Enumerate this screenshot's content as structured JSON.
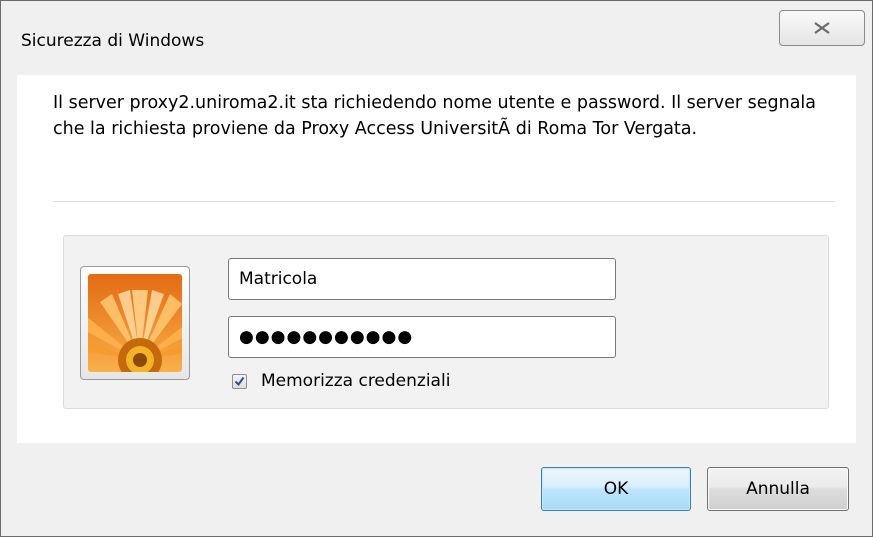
{
  "window": {
    "title": "Sicurezza di Windows",
    "close_icon": "close-icon"
  },
  "message": {
    "text": "Il server proxy2.uniroma2.it sta richiedendo nome utente e password. Il server segnala che la richiesta proviene da Proxy Access UniversitÃ  di Roma Tor Vergata."
  },
  "credentials": {
    "avatar_icon": "user-tile-flower-icon",
    "username_value": "Matricola",
    "password_value": "●●●●●●●●●●●",
    "remember_label": "Memorizza credenziali",
    "remember_checked": true
  },
  "buttons": {
    "ok_label": "OK",
    "cancel_label": "Annulla"
  },
  "colors": {
    "ok_accent": "#3c7fb1",
    "flower_orange": "#f7931e"
  }
}
